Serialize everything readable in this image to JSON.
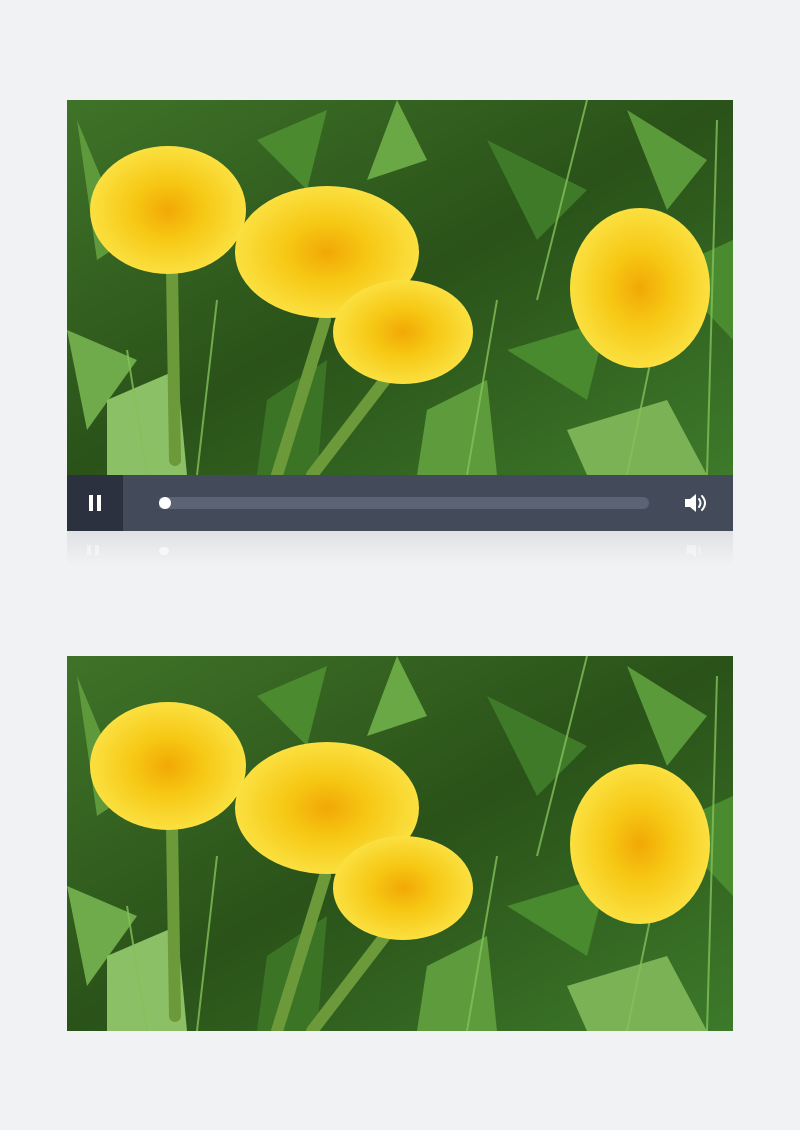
{
  "player": {
    "progress": 0,
    "state": "playing",
    "icons": {
      "pause": "pause-icon",
      "volume": "volume-icon"
    },
    "colors": {
      "control_bar": "#434a5a",
      "play_button_bg": "#2c3140",
      "track": "#5c6375",
      "knob": "#ffffff"
    }
  },
  "preview": {
    "icon": "image"
  },
  "colors": {
    "background": "#f1f2f3",
    "flower": "#f6d21a",
    "flower_center": "#f2ac06",
    "foliage": "#2f5a1e"
  }
}
